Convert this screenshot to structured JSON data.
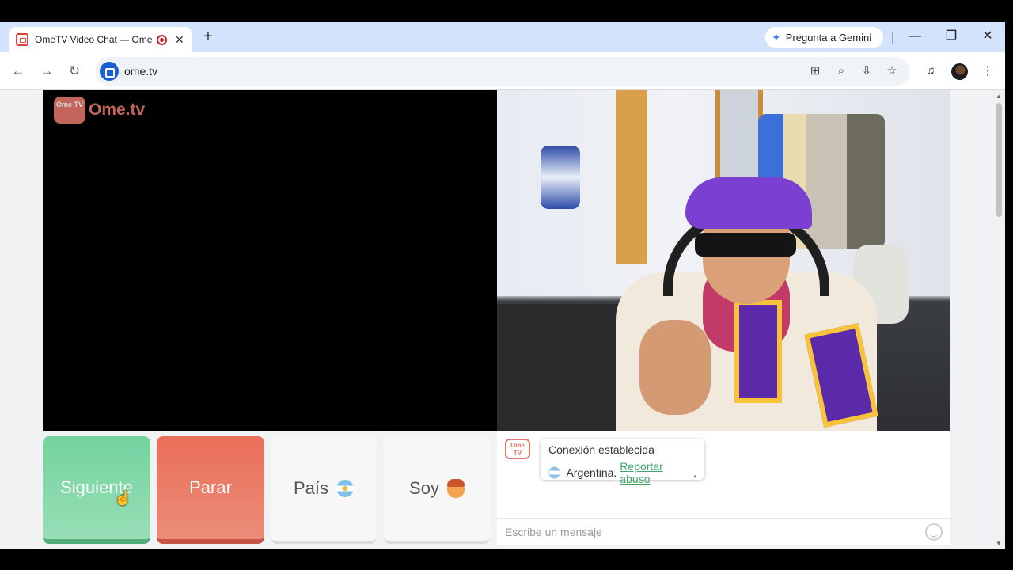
{
  "browser": {
    "tab_title": "OmeTV Video Chat — Ome",
    "tab_close": "✕",
    "new_tab": "+",
    "gemini_label": "Pregunta a Gemini",
    "window_minimize": "—",
    "window_restore": "❐",
    "window_close": "✕",
    "url": "ome.tv"
  },
  "site": {
    "logo_tv": "Ome TV",
    "logo_name": "Ome.tv"
  },
  "controls": {
    "next_label": "Siguiente",
    "stop_label": "Parar",
    "country_label": "País",
    "me_label": "Soy"
  },
  "chat": {
    "logo_text": "Ome TV",
    "status_text": "Conexión establecida",
    "country_text": "Argentina.",
    "report_link": "Reportar abuso",
    "report_suffix": ".",
    "input_placeholder": "Escribe un mensaje"
  },
  "colors": {
    "next_button": "#73d39f",
    "stop_button": "#ea6f59",
    "report_link": "#41a36a",
    "brand": "#e5776a"
  }
}
